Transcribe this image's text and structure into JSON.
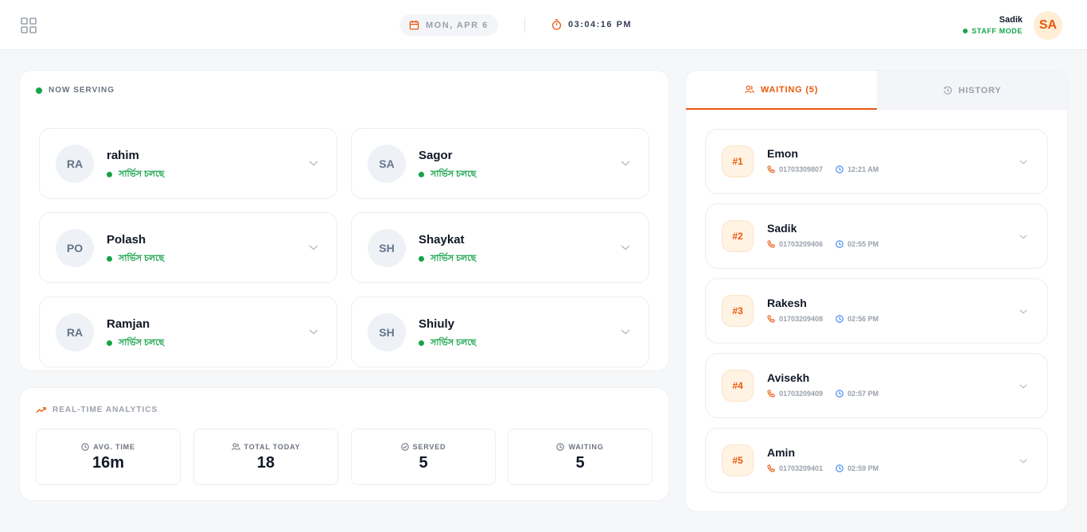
{
  "header": {
    "date": "MON, APR 6",
    "time": "03:04:16 PM",
    "user_name": "Sadik",
    "user_mode": "STAFF MODE",
    "user_initials": "SA"
  },
  "serving": {
    "title": "NOW SERVING",
    "items": [
      {
        "initials": "RA",
        "name": "rahim",
        "status": "সার্ভিস চলছে"
      },
      {
        "initials": "SA",
        "name": "Sagor",
        "status": "সার্ভিস চলছে"
      },
      {
        "initials": "PO",
        "name": "Polash",
        "status": "সার্ভিস চলছে"
      },
      {
        "initials": "SH",
        "name": "Shaykat",
        "status": "সার্ভিস চলছে"
      },
      {
        "initials": "RA",
        "name": "Ramjan",
        "status": "সার্ভিস চলছে"
      },
      {
        "initials": "SH",
        "name": "Shiuly",
        "status": "সার্ভিস চলছে"
      }
    ]
  },
  "analytics": {
    "title": "REAL-TIME ANALYTICS",
    "stats": [
      {
        "label": "AVG. TIME",
        "value": "16m",
        "icon": "clock-icon"
      },
      {
        "label": "TOTAL TODAY",
        "value": "18",
        "icon": "users-icon"
      },
      {
        "label": "SERVED",
        "value": "5",
        "icon": "check-circle-icon"
      },
      {
        "label": "WAITING",
        "value": "5",
        "icon": "clock-icon"
      }
    ]
  },
  "queue": {
    "tabs": {
      "waiting": "WAITING (5)",
      "history": "HISTORY"
    },
    "items": [
      {
        "token": "#1",
        "name": "Emon",
        "phone": "01703309807",
        "time": "12:21 AM"
      },
      {
        "token": "#2",
        "name": "Sadik",
        "phone": "01703209406",
        "time": "02:55 PM"
      },
      {
        "token": "#3",
        "name": "Rakesh",
        "phone": "01703209408",
        "time": "02:56 PM"
      },
      {
        "token": "#4",
        "name": "Avisekh",
        "phone": "01703209409",
        "time": "02:57 PM"
      },
      {
        "token": "#5",
        "name": "Amin",
        "phone": "01703209401",
        "time": "02:59 PM"
      }
    ]
  },
  "colors": {
    "accent": "#ea580c",
    "success": "#16a34a"
  }
}
